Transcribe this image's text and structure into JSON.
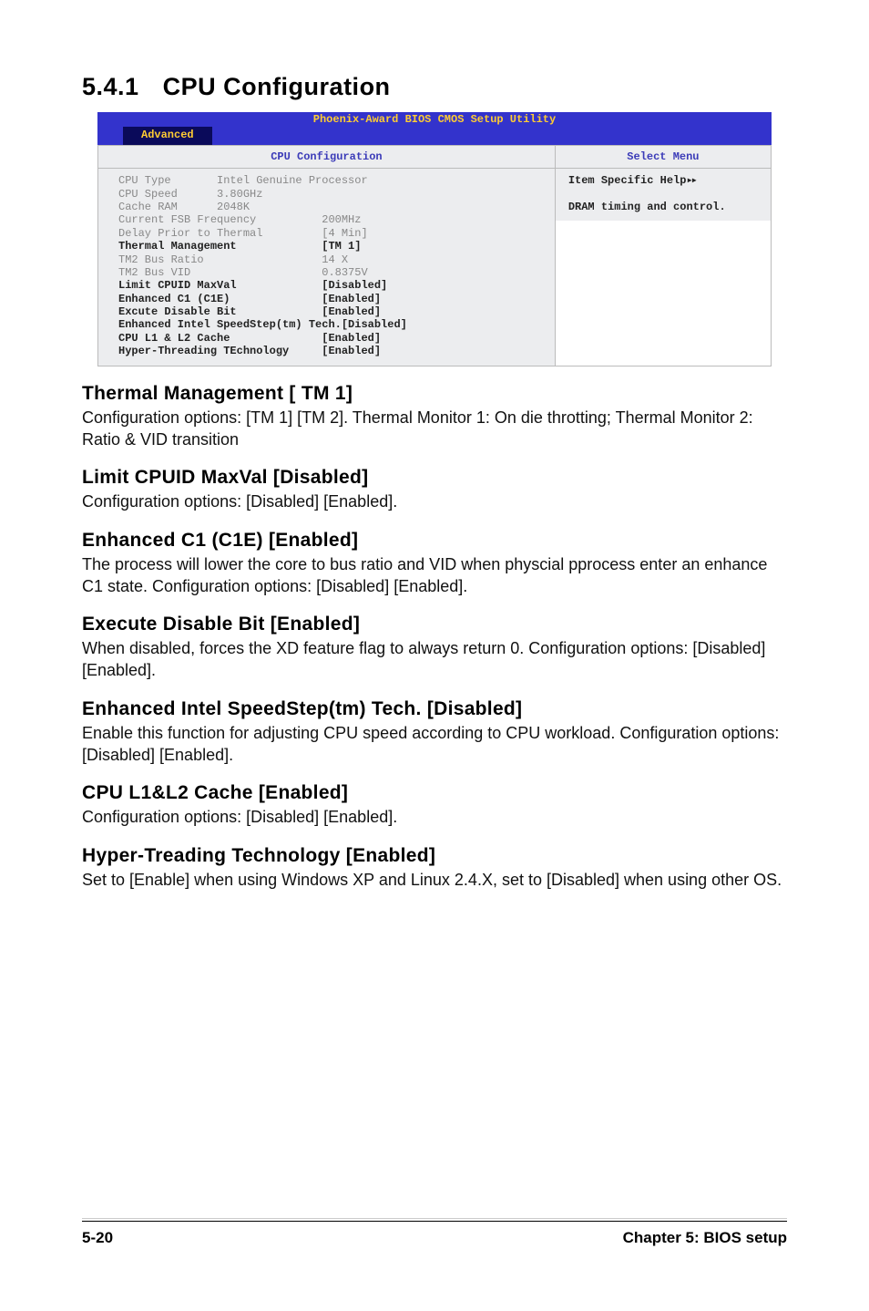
{
  "section": {
    "number": "5.4.1",
    "title": "CPU Configuration"
  },
  "bios": {
    "utility_title": "Phoenix-Award BIOS CMOS Setup Utility",
    "tab": "Advanced",
    "left_header": "CPU Configuration",
    "right_header": "Select Menu",
    "help_line1": "Item Specific Help",
    "help_arrows": "▸▸",
    "help_line2": "DRAM timing and control.",
    "rows": [
      {
        "label": "CPU Type",
        "value": "Intel Genuine Processor",
        "bold": false,
        "pad": 7
      },
      {
        "label": "CPU Speed",
        "value": "3.80GHz",
        "bold": false,
        "pad": 6
      },
      {
        "label": "Cache RAM",
        "value": "2048K",
        "bold": false,
        "pad": 6
      },
      {
        "label": "Current FSB Frequency",
        "value": "200MHz",
        "bold": false,
        "pad": 10
      },
      {
        "label": "Delay Prior to Thermal",
        "value": "[4 Min]",
        "bold": false,
        "pad": 9
      },
      {
        "label": "Thermal Management",
        "value": "[TM 1]",
        "bold": true,
        "pad": 13
      },
      {
        "label": "TM2 Bus Ratio",
        "value": "14 X",
        "bold": false,
        "pad": 18
      },
      {
        "label": "TM2 Bus VID",
        "value": "0.8375V",
        "bold": false,
        "pad": 20
      },
      {
        "label": "Limit CPUID MaxVal",
        "value": "[Disabled]",
        "bold": true,
        "pad": 13
      },
      {
        "label": "Enhanced C1 (C1E)",
        "value": "[Enabled]",
        "bold": true,
        "pad": 14
      },
      {
        "label": "Excute Disable Bit",
        "value": "[Enabled]",
        "bold": true,
        "pad": 13
      },
      {
        "label": "Enhanced Intel SpeedStep(tm) Tech.",
        "value": "[Disabled]",
        "bold": true,
        "pad": 0
      },
      {
        "label": "CPU L1 & L2 Cache",
        "value": "[Enabled]",
        "bold": true,
        "pad": 14
      },
      {
        "label": "Hyper-Threading TEchnology",
        "value": "[Enabled]",
        "bold": true,
        "pad": 5
      }
    ]
  },
  "sections": [
    {
      "h": "Thermal Management [ TM 1]",
      "p": "Configuration options: [TM 1] [TM 2]. Thermal Monitor 1: On die throtting; Thermal Monitor 2: Ratio & VID transition"
    },
    {
      "h": "Limit CPUID MaxVal [Disabled]",
      "p": "Configuration options: [Disabled] [Enabled]."
    },
    {
      "h": "Enhanced C1 (C1E) [Enabled]",
      "p": "The process will lower the core to bus ratio and VID when physcial pprocess enter an enhance C1 state. Configuration options: [Disabled] [Enabled]."
    },
    {
      "h": "Execute Disable Bit [Enabled]",
      "p": "When disabled, forces the XD feature flag to always return 0. Configuration options: [Disabled] [Enabled]."
    },
    {
      "h": "Enhanced Intel SpeedStep(tm) Tech. [Disabled]",
      "p": "Enable this function for adjusting CPU speed according to CPU workload. Configuration options: [Disabled] [Enabled]."
    },
    {
      "h": "CPU L1&L2 Cache [Enabled]",
      "p": "Configuration options: [Disabled] [Enabled]."
    },
    {
      "h": "Hyper-Treading Technology [Enabled]",
      "p": "Set to [Enable] when using Windows XP and Linux 2.4.X, set to [Disabled] when using other OS."
    }
  ],
  "footer": {
    "left": "5-20",
    "right": "Chapter 5: BIOS setup"
  }
}
